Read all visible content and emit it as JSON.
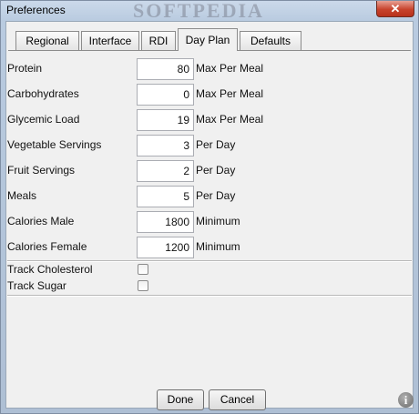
{
  "window": {
    "title": "Preferences",
    "watermark": "SOFTPEDIA",
    "close_glyph": "✕"
  },
  "tabs": [
    {
      "label": "Regional",
      "active": false
    },
    {
      "label": "Interface",
      "active": false
    },
    {
      "label": "RDI",
      "active": false
    },
    {
      "label": "Day Plan",
      "active": true
    },
    {
      "label": "Defaults",
      "active": false
    }
  ],
  "fields": [
    {
      "label": "Protein",
      "value": "80",
      "unit": "Max Per Meal"
    },
    {
      "label": "Carbohydrates",
      "value": "0",
      "unit": "Max Per Meal"
    },
    {
      "label": "Glycemic Load",
      "value": "19",
      "unit": "Max Per Meal"
    },
    {
      "label": "Vegetable Servings",
      "value": "3",
      "unit": "Per Day"
    },
    {
      "label": "Fruit Servings",
      "value": "2",
      "unit": "Per Day"
    },
    {
      "label": "Meals",
      "value": "5",
      "unit": "Per Day"
    },
    {
      "label": "Calories Male",
      "value": "1800",
      "unit": "Minimum"
    },
    {
      "label": "Calories Female",
      "value": "1200",
      "unit": "Minimum"
    }
  ],
  "checks": [
    {
      "label": "Track Cholesterol",
      "checked": false
    },
    {
      "label": "Track Sugar",
      "checked": false
    }
  ],
  "buttons": {
    "done": "Done",
    "cancel": "Cancel"
  },
  "icons": {
    "info": "info-icon",
    "info_glyph": "i"
  }
}
